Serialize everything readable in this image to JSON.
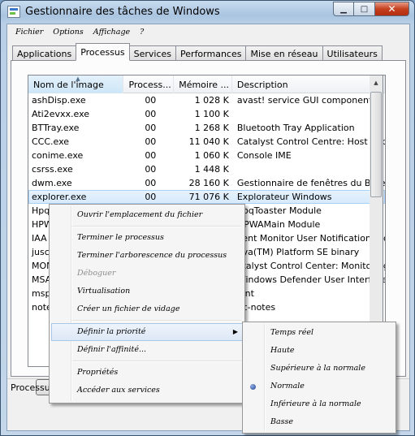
{
  "window": {
    "title": "Gestionnaire des tâches de Windows",
    "minimize_glyph": "▁",
    "maximize_glyph": "□",
    "close_glyph": "✕"
  },
  "menubar": {
    "items": [
      {
        "label": "Fichier"
      },
      {
        "label": "Options"
      },
      {
        "label": "Affichage"
      },
      {
        "label": "?"
      }
    ]
  },
  "tabs": [
    {
      "label": "Applications",
      "active": false
    },
    {
      "label": "Processus",
      "active": true
    },
    {
      "label": "Services",
      "active": false
    },
    {
      "label": "Performances",
      "active": false
    },
    {
      "label": "Mise en réseau",
      "active": false
    },
    {
      "label": "Utilisateurs",
      "active": false
    }
  ],
  "table": {
    "headers": [
      "Nom de l'image",
      "Process...",
      "Mémoire ...",
      "Description"
    ],
    "rows": [
      {
        "name": "ashDisp.exe",
        "cpu": "00",
        "mem": "1 028 K",
        "desc": "avast! service GUI component"
      },
      {
        "name": "Ati2evxx.exe",
        "cpu": "00",
        "mem": "1 100 K",
        "desc": ""
      },
      {
        "name": "BTTray.exe",
        "cpu": "00",
        "mem": "1 268 K",
        "desc": "Bluetooth Tray Application"
      },
      {
        "name": "CCC.exe",
        "cpu": "00",
        "mem": "11 040 K",
        "desc": "Catalyst Control Centre: Host applic"
      },
      {
        "name": "conime.exe",
        "cpu": "00",
        "mem": "1 060 K",
        "desc": "Console IME"
      },
      {
        "name": "csrss.exe",
        "cpu": "00",
        "mem": "1 448 K",
        "desc": ""
      },
      {
        "name": "dwm.exe",
        "cpu": "00",
        "mem": "28 160 K",
        "desc": "Gestionnaire de fenêtres du Bureau"
      },
      {
        "name": "explorer.exe",
        "cpu": "00",
        "mem": "71 076 K",
        "desc": "Explorateur Windows",
        "selected": true
      },
      {
        "name": "Hpq",
        "cpu": "",
        "mem": "",
        "desc": "hpqToaster Module"
      },
      {
        "name": "HPW",
        "cpu": "",
        "mem": "",
        "desc": "HPWAMain Module"
      },
      {
        "name": "IAA",
        "cpu": "",
        "mem": "",
        "desc": "vent Monitor User Notification Tool"
      },
      {
        "name": "jusc",
        "cpu": "",
        "mem": "",
        "desc": "ava(TM) Platform SE binary"
      },
      {
        "name": "MOM",
        "cpu": "",
        "mem": "",
        "desc": "atalyst Control Center: Monitoring"
      },
      {
        "name": "MSA",
        "cpu": "",
        "mem": "",
        "desc": "Windows Defender User Interface"
      },
      {
        "name": "msp",
        "cpu": "",
        "mem": "",
        "desc": "aint"
      },
      {
        "name": "note",
        "cpu": "",
        "mem": "",
        "desc": "oc-notes"
      }
    ]
  },
  "statusbar": {
    "processes_label": "Processu"
  },
  "context_menu": {
    "items": [
      {
        "label": "Ouvrir l'emplacement du fichier"
      },
      {
        "sep": true
      },
      {
        "label": "Terminer le processus"
      },
      {
        "label": "Terminer l'arborescence du processus"
      },
      {
        "label": "Déboguer",
        "disabled": true
      },
      {
        "label": "Virtualisation"
      },
      {
        "label": "Créer un fichier de vidage"
      },
      {
        "sep": true
      },
      {
        "label": "Définir la priorité",
        "submenu": true,
        "highlighted": true
      },
      {
        "label": "Définir l'affinité..."
      },
      {
        "sep": true
      },
      {
        "label": "Propriétés"
      },
      {
        "label": "Accéder aux services"
      }
    ],
    "submenu_glyph": "▶"
  },
  "priority_submenu": {
    "items": [
      {
        "label": "Temps réel",
        "checked": false
      },
      {
        "label": "Haute",
        "checked": false
      },
      {
        "label": "Supérieure à la normale",
        "checked": false
      },
      {
        "label": "Normale",
        "checked": true
      },
      {
        "label": "Inférieure à la normale",
        "checked": false
      },
      {
        "label": "Basse",
        "checked": false
      }
    ]
  }
}
